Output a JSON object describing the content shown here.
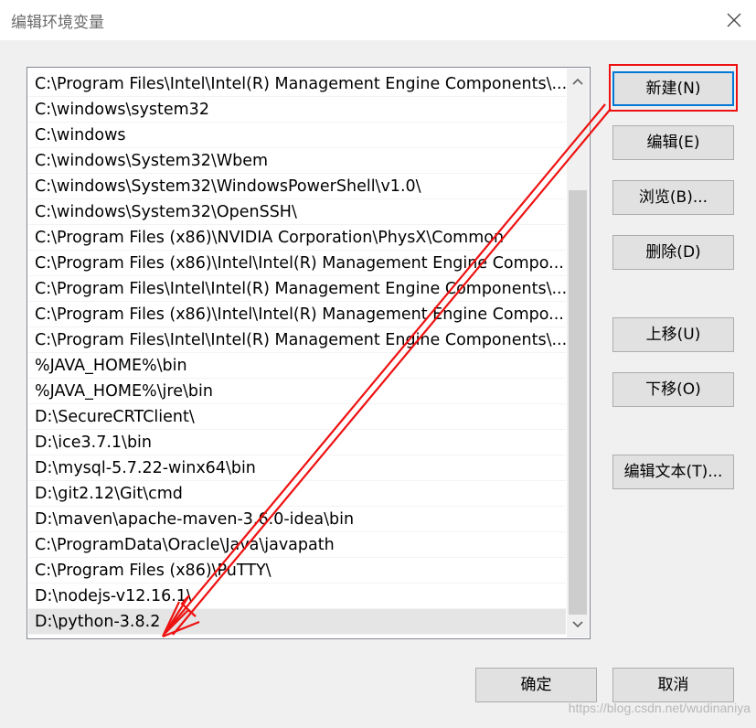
{
  "dialog": {
    "title": "编辑环境变量"
  },
  "path_list": {
    "items": [
      "C:\\Program Files\\Intel\\Intel(R) Management Engine Components\\...",
      "C:\\windows\\system32",
      "C:\\windows",
      "C:\\windows\\System32\\Wbem",
      "C:\\windows\\System32\\WindowsPowerShell\\v1.0\\",
      "C:\\windows\\System32\\OpenSSH\\",
      "C:\\Program Files (x86)\\NVIDIA Corporation\\PhysX\\Common",
      "C:\\Program Files (x86)\\Intel\\Intel(R) Management Engine Compo...",
      "C:\\Program Files\\Intel\\Intel(R) Management Engine Components\\...",
      "C:\\Program Files (x86)\\Intel\\Intel(R) Management Engine Compo...",
      "C:\\Program Files\\Intel\\Intel(R) Management Engine Components\\...",
      "%JAVA_HOME%\\bin",
      "%JAVA_HOME%\\jre\\bin",
      "D:\\SecureCRTClient\\",
      "D:\\ice3.7.1\\bin",
      "D:\\mysql-5.7.22-winx64\\bin",
      "D:\\git2.12\\Git\\cmd",
      "D:\\maven\\apache-maven-3.6.0-idea\\bin",
      "C:\\ProgramData\\Oracle\\Java\\javapath",
      "C:\\Program Files (x86)\\PuTTY\\",
      "D:\\nodejs-v12.16.1\\",
      "D:\\python-3.8.2"
    ],
    "selected_index": 21
  },
  "buttons": {
    "new": "新建(N)",
    "edit": "编辑(E)",
    "browse": "浏览(B)...",
    "delete": "删除(D)",
    "move_up": "上移(U)",
    "move_down": "下移(O)",
    "edit_text": "编辑文本(T)...",
    "ok": "确定",
    "cancel": "取消"
  },
  "watermark": "https://blog.csdn.net/wudinaniya",
  "colors": {
    "annotation": "#ee1111",
    "selection": "#e5e5e5"
  }
}
